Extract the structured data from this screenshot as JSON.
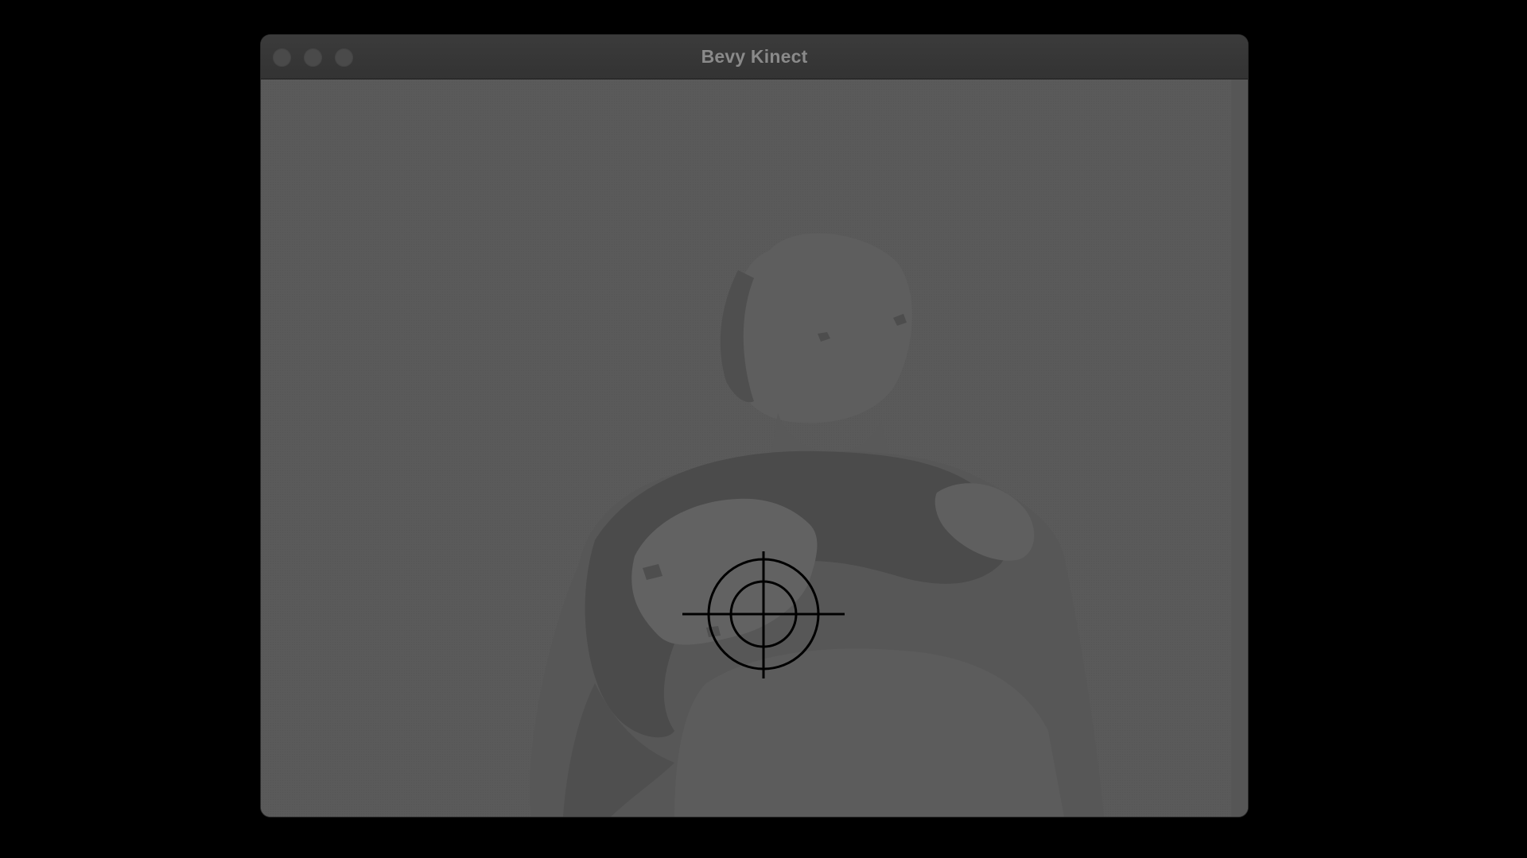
{
  "window": {
    "title": "Bevy Kinect",
    "controls": {
      "close": "close-icon",
      "minimize": "minimize-icon",
      "zoom": "zoom-icon"
    }
  },
  "viewport": {
    "content": "kinect-depth-feed",
    "cursor": "crosshair-icon"
  },
  "colors": {
    "desktop_background": "#000000",
    "titlebar": "#373737",
    "title_text": "#8a8a8a",
    "depth_far": "#595959",
    "depth_mid": "#535353",
    "depth_near": "#4a4a4a",
    "depth_highlight": "#626262",
    "crosshair": "#000000"
  }
}
